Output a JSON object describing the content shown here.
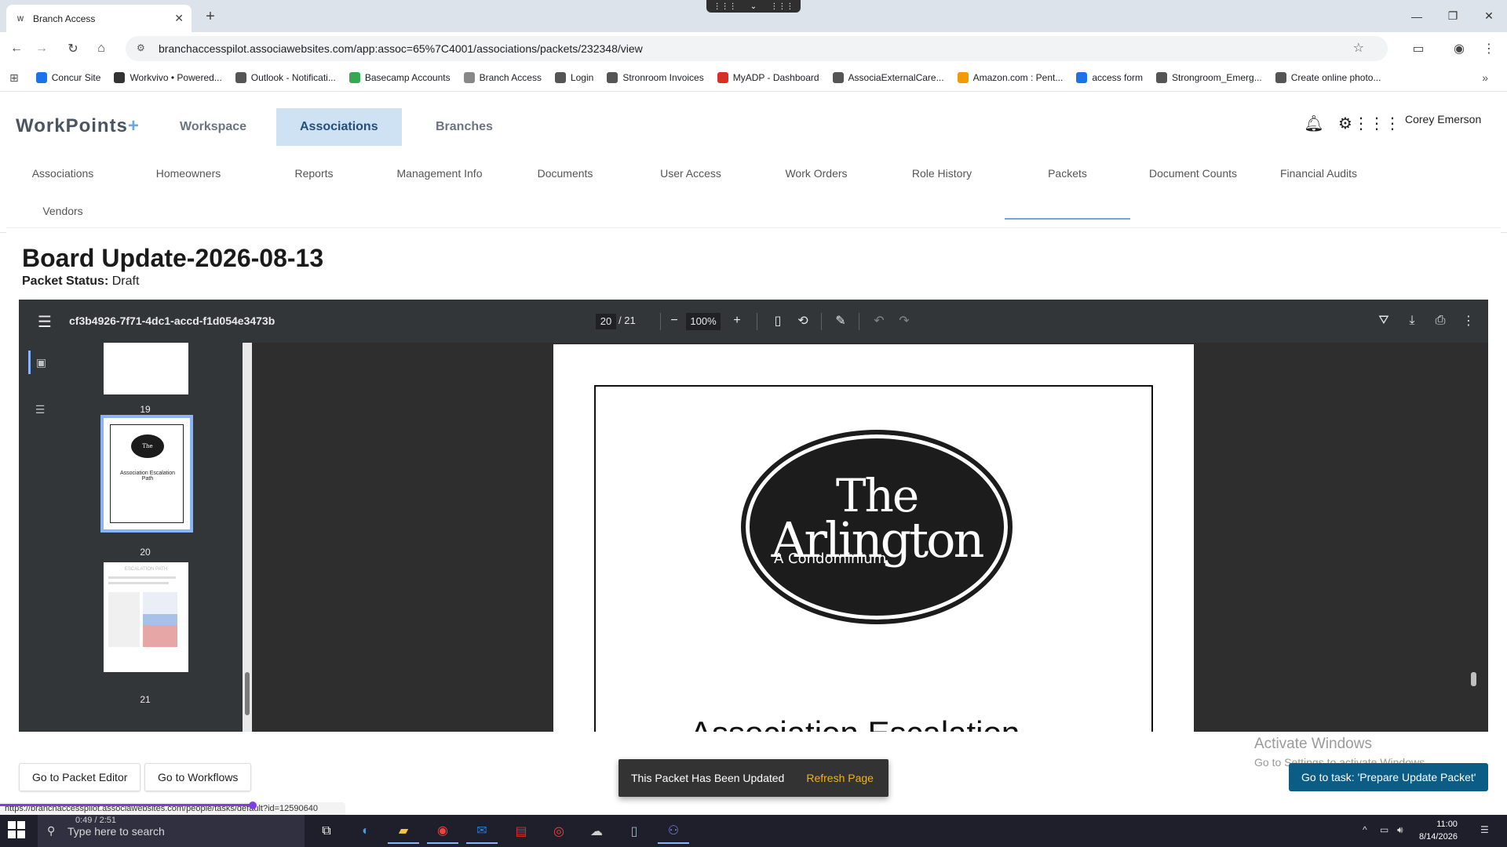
{
  "browser": {
    "tab_title": "Branch Access",
    "tab_favicon_text": "W",
    "new_tab_symbol": "+",
    "url": "branchaccesspilot.associawebsites.com/app:assoc=65%7C4001/associations/packets/232348/view",
    "status_url": "https://branchaccesspilot.associawebsites.com/people/tasks/default?id=12590640",
    "bookmarks": [
      {
        "label": "Concur Site",
        "color": "#1a73e8"
      },
      {
        "label": "Workvivo • Powered...",
        "color": "#333333"
      },
      {
        "label": "Outlook - Notificati...",
        "color": "#555555"
      },
      {
        "label": "Basecamp Accounts",
        "color": "#34a853"
      },
      {
        "label": "Branch Access",
        "color": "#888888"
      },
      {
        "label": "Login",
        "color": "#555555"
      },
      {
        "label": "Stronroom Invoices",
        "color": "#555555"
      },
      {
        "label": "MyADP - Dashboard",
        "color": "#d93025"
      },
      {
        "label": "AssociaExternalCare...",
        "color": "#555555"
      },
      {
        "label": "Amazon.com : Pent...",
        "color": "#f29900"
      },
      {
        "label": "access form",
        "color": "#1a73e8"
      },
      {
        "label": "Strongroom_Emerg...",
        "color": "#555555"
      },
      {
        "label": "Create online photo...",
        "color": "#555555"
      }
    ]
  },
  "app": {
    "logo_main": "WorkPoints",
    "logo_plus": "+",
    "topnav": [
      {
        "label": "Workspace",
        "active": false
      },
      {
        "label": "Associations",
        "active": true
      },
      {
        "label": "Branches",
        "active": false
      }
    ],
    "user_name": "Corey Emerson",
    "icons": [
      "bell-icon",
      "gear-icon",
      "apps-grid-icon"
    ],
    "subnav": [
      "Associations",
      "Homeowners",
      "Reports",
      "Management Info",
      "Documents",
      "User Access",
      "Work Orders",
      "Role History",
      "Packets",
      "Document Counts",
      "Financial Audits",
      "Vendors"
    ],
    "active_subnav": "Packets"
  },
  "packet": {
    "title": "Board Update-2026-08-13",
    "status_label": "Packet Status:",
    "status_value": "Draft"
  },
  "viewer": {
    "filename": "cf3b4926-7f71-4dc1-accd-f1d054e3473b",
    "current_page": "20",
    "total_pages": "/ 21",
    "zoom": "100%",
    "thumbnails": [
      {
        "page": "19"
      },
      {
        "page": "20",
        "selected": true,
        "logo_text": "The Arlington",
        "caption": "Association Escalation Path"
      },
      {
        "page": "21",
        "heading": "ESCALATION PATH"
      }
    ],
    "document": {
      "logo_line1": "The",
      "logo_line2": "Arlington",
      "logo_line3": "A Condominium",
      "heading_partial": "Association Escalation"
    }
  },
  "footer": {
    "packet_editor_button": "Go to Packet Editor",
    "workflows_button": "Go to Workflows",
    "toast_message": "This Packet Has Been Updated",
    "toast_action": "Refresh Page",
    "task_button": "Go to task: 'Prepare Update Packet'",
    "watermark_title": "Activate Windows",
    "watermark_sub": "Go to Settings to activate Windows."
  },
  "media": {
    "time": "0:49 / 2:51",
    "progress_fraction": 0.19
  },
  "taskbar": {
    "search_placeholder": "Type here to search",
    "time": "11:00",
    "date": "8/14/2026"
  }
}
